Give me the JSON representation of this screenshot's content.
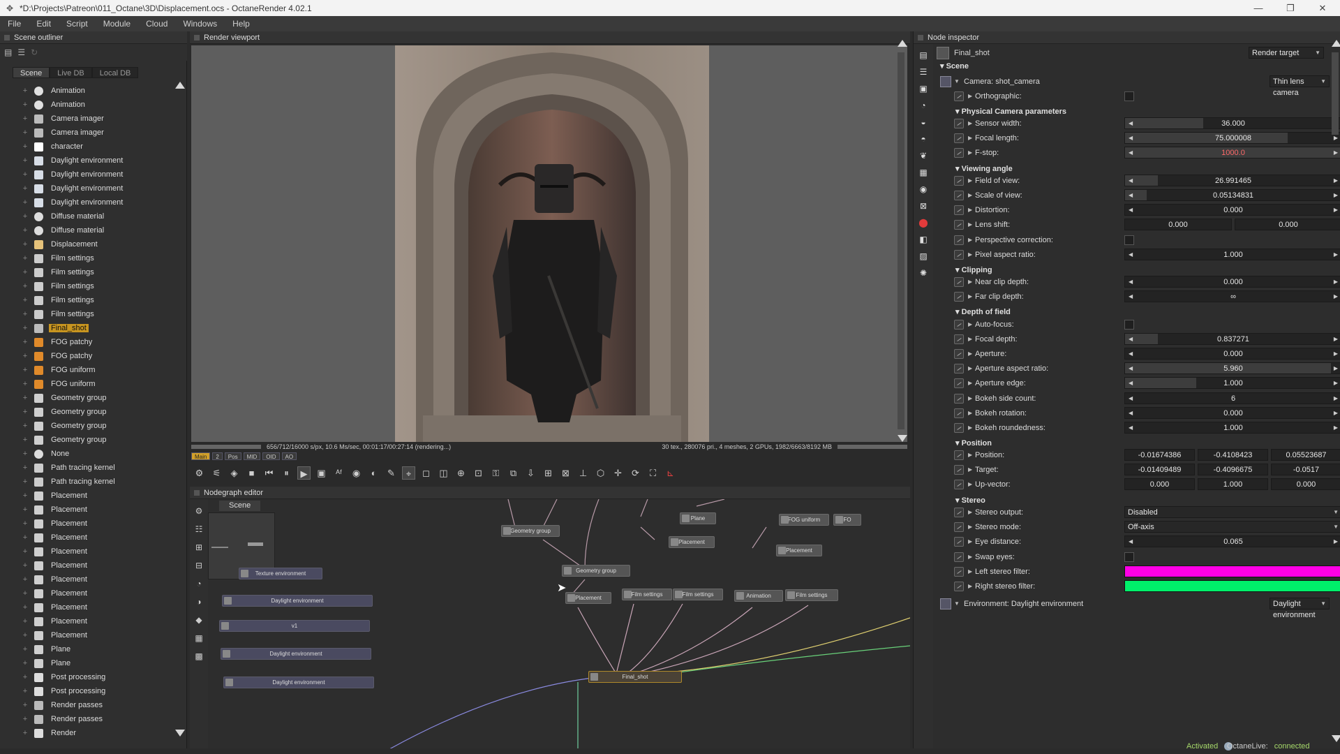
{
  "window": {
    "title": "*D:\\Projects\\Patreon\\011_Octane\\3D\\Displacement.ocs - OctaneRender 4.02.1",
    "minimize": "—",
    "restore": "❐",
    "close": "✕"
  },
  "menu": [
    "File",
    "Edit",
    "Script",
    "Module",
    "Cloud",
    "Windows",
    "Help"
  ],
  "outliner": {
    "title": "Scene outliner",
    "tabs": [
      "Scene",
      "Live DB",
      "Local DB"
    ],
    "items": [
      {
        "label": "Animation",
        "icon": "animation-icon"
      },
      {
        "label": "Animation",
        "icon": "animation-icon"
      },
      {
        "label": "Camera imager",
        "icon": "imager-icon"
      },
      {
        "label": "Camera imager",
        "icon": "imager-icon"
      },
      {
        "label": "character",
        "icon": "mesh-icon"
      },
      {
        "label": "Daylight environment",
        "icon": "environment-icon"
      },
      {
        "label": "Daylight environment",
        "icon": "environment-icon"
      },
      {
        "label": "Daylight environment",
        "icon": "environment-icon"
      },
      {
        "label": "Daylight environment",
        "icon": "environment-icon"
      },
      {
        "label": "Diffuse material",
        "icon": "material-icon"
      },
      {
        "label": "Diffuse material",
        "icon": "material-icon"
      },
      {
        "label": "Displacement",
        "icon": "displacement-icon"
      },
      {
        "label": "Film settings",
        "icon": "film-icon"
      },
      {
        "label": "Film settings",
        "icon": "film-icon"
      },
      {
        "label": "Film settings",
        "icon": "film-icon"
      },
      {
        "label": "Film settings",
        "icon": "film-icon"
      },
      {
        "label": "Film settings",
        "icon": "film-icon"
      },
      {
        "label": "Final_shot",
        "icon": "render-target-icon",
        "selected": true
      },
      {
        "label": "FOG patchy",
        "icon": "fog-icon"
      },
      {
        "label": "FOG patchy",
        "icon": "fog-icon"
      },
      {
        "label": "FOG uniform",
        "icon": "fog-icon"
      },
      {
        "label": "FOG uniform",
        "icon": "fog-icon"
      },
      {
        "label": "Geometry group",
        "icon": "geometry-icon"
      },
      {
        "label": "Geometry group",
        "icon": "geometry-icon"
      },
      {
        "label": "Geometry group",
        "icon": "geometry-icon"
      },
      {
        "label": "Geometry group",
        "icon": "geometry-icon"
      },
      {
        "label": "None",
        "icon": "sphere-icon"
      },
      {
        "label": "Path tracing kernel",
        "icon": "kernel-icon"
      },
      {
        "label": "Path tracing kernel",
        "icon": "kernel-icon"
      },
      {
        "label": "Placement",
        "icon": "placement-icon"
      },
      {
        "label": "Placement",
        "icon": "placement-icon"
      },
      {
        "label": "Placement",
        "icon": "placement-icon"
      },
      {
        "label": "Placement",
        "icon": "placement-icon"
      },
      {
        "label": "Placement",
        "icon": "placement-icon"
      },
      {
        "label": "Placement",
        "icon": "placement-icon"
      },
      {
        "label": "Placement",
        "icon": "placement-icon"
      },
      {
        "label": "Placement",
        "icon": "placement-icon"
      },
      {
        "label": "Placement",
        "icon": "placement-icon"
      },
      {
        "label": "Placement",
        "icon": "placement-icon"
      },
      {
        "label": "Placement",
        "icon": "placement-icon"
      },
      {
        "label": "Plane",
        "icon": "geometry-icon"
      },
      {
        "label": "Plane",
        "icon": "geometry-icon"
      },
      {
        "label": "Post processing",
        "icon": "postprocess-icon"
      },
      {
        "label": "Post processing",
        "icon": "postprocess-icon"
      },
      {
        "label": "Render passes",
        "icon": "passes-icon"
      },
      {
        "label": "Render passes",
        "icon": "passes-icon"
      },
      {
        "label": "Render",
        "icon": "render-icon"
      }
    ]
  },
  "viewport": {
    "title": "Render viewport",
    "status_left": "656/712/16000 s/px, 10.6 Ms/sec, 00:01:17/00:27:14 (rendering...)",
    "status_right": "30 tex., 280076 pri., 4 meshes, 2 GPUs, 1982/6663/8192 MB",
    "chips": [
      "Main",
      "2",
      "Pos",
      "MID",
      "OID",
      "AO"
    ]
  },
  "nodegraph": {
    "title": "Nodegraph editor",
    "tab": "Scene",
    "nodes": [
      "Texture environment",
      "Daylight environment",
      "v1",
      "Daylight environment",
      "Daylight environment",
      "Geometry group",
      "Geometry group",
      "Placement",
      "Plane",
      "Placement",
      "FOG uniform",
      "Placement",
      "FO",
      "Film settings",
      "Film settings",
      "Animation",
      "Film settings",
      "Final_shot"
    ]
  },
  "inspector": {
    "title": "Node inspector",
    "node_name": "Final_shot",
    "node_type": "Render target",
    "scene_label": "Scene",
    "camera": {
      "label": "Camera: shot_camera",
      "type": "Thin lens camera"
    },
    "orthographic": "Orthographic:",
    "sections": {
      "physical": "Physical Camera parameters",
      "viewing": "Viewing angle",
      "clipping": "Clipping",
      "dof": "Depth of field",
      "position": "Position",
      "stereo": "Stereo"
    },
    "params": {
      "sensor_width": {
        "label": "Sensor width:",
        "value": "36.000",
        "fill": 0.36
      },
      "focal_length": {
        "label": "Focal length:",
        "value": "75.000008",
        "fill": 0.75
      },
      "fstop": {
        "label": "F-stop:",
        "value": "1000.0",
        "fill": 1.0
      },
      "fov": {
        "label": "Field of view:",
        "value": "26.991465",
        "fill": 0.15
      },
      "scale_of_view": {
        "label": "Scale of view:",
        "value": "0.05134831",
        "fill": 0.1
      },
      "distortion": {
        "label": "Distortion:",
        "value": "0.000",
        "fill": 0.0
      },
      "lens_shift": {
        "label": "Lens shift:",
        "x": "0.000",
        "y": "0.000"
      },
      "perspective_correction": {
        "label": "Perspective correction:"
      },
      "pixel_aspect": {
        "label": "Pixel aspect ratio:",
        "value": "1.000",
        "fill": 0.0
      },
      "near_clip": {
        "label": "Near clip depth:",
        "value": "0.000",
        "fill": 0.0
      },
      "far_clip": {
        "label": "Far clip depth:",
        "value": "∞",
        "fill": 0.0
      },
      "autofocus": {
        "label": "Auto-focus:"
      },
      "focal_depth": {
        "label": "Focal depth:",
        "value": "0.837271",
        "fill": 0.15
      },
      "aperture": {
        "label": "Aperture:",
        "value": "0.000",
        "fill": 0.0
      },
      "aperture_aspect": {
        "label": "Aperture aspect ratio:",
        "value": "5.960",
        "fill": 0.95
      },
      "aperture_edge": {
        "label": "Aperture edge:",
        "value": "1.000",
        "fill": 0.33
      },
      "bokeh_side": {
        "label": "Bokeh side count:",
        "value": "6",
        "fill": 0.0
      },
      "bokeh_rotation": {
        "label": "Bokeh rotation:",
        "value": "0.000",
        "fill": 0.0
      },
      "bokeh_roundedness": {
        "label": "Bokeh roundedness:",
        "value": "1.000",
        "fill": 0.0
      },
      "position": {
        "label": "Position:",
        "x": "-0.01674386",
        "y": "-0.4108423",
        "z": "0.05523687"
      },
      "target": {
        "label": "Target:",
        "x": "-0.01409489",
        "y": "-0.4096675",
        "z": "-0.0517"
      },
      "up_vector": {
        "label": "Up-vector:",
        "x": "0.000",
        "y": "1.000",
        "z": "0.000"
      },
      "stereo_output": {
        "label": "Stereo output:",
        "value": "Disabled"
      },
      "stereo_mode": {
        "label": "Stereo mode:",
        "value": "Off-axis"
      },
      "eye_distance": {
        "label": "Eye distance:",
        "value": "0.065",
        "fill": 0.0
      },
      "swap_eyes": {
        "label": "Swap eyes:"
      },
      "left_filter": {
        "label": "Left stereo filter:",
        "color": "#ff00e6"
      },
      "right_filter": {
        "label": "Right stereo filter:",
        "color": "#00f06a"
      }
    },
    "environment": {
      "label": "Environment: Daylight environment",
      "type": "Daylight environment"
    }
  },
  "status": {
    "activated": "Activated",
    "octanelive_label": "OctaneLive:",
    "octanelive_value": "connected"
  }
}
